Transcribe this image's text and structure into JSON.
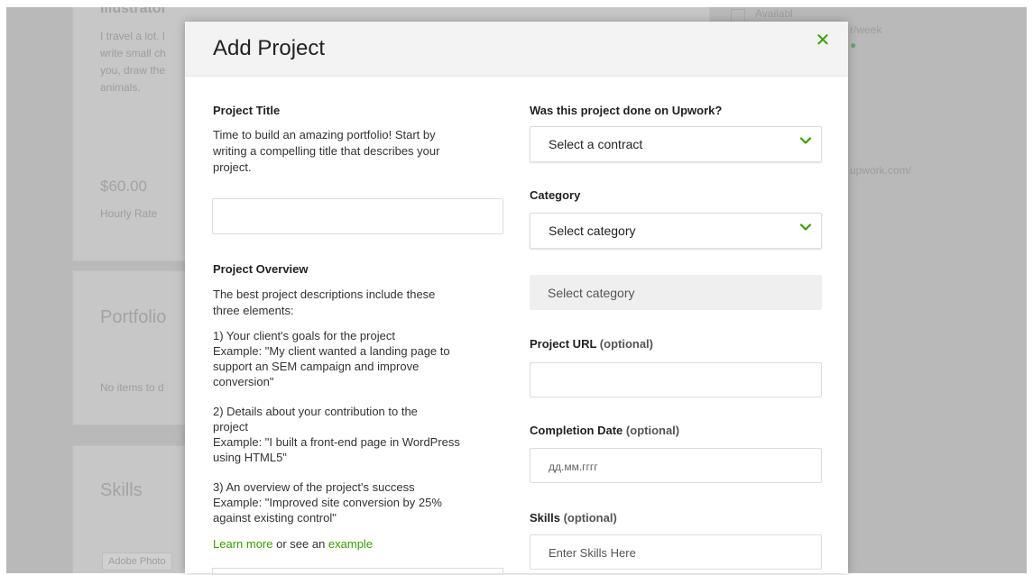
{
  "background": {
    "profile_title": "Illustrator",
    "bio_lines": [
      "I travel a lot. I",
      "write small ch",
      "you, draw the",
      "animals."
    ],
    "rate": "$60.00",
    "rate_label": "Hourly Rate",
    "portfolio_heading": "Portfolio",
    "portfolio_empty": "No items to d",
    "skills_heading": "Skills",
    "skill_chip": "Adobe Photo",
    "availability": "Availabl",
    "right_text_1": "r/week",
    "right_url": "upwork.com/"
  },
  "modal": {
    "title": "Add Project",
    "close_glyph": "✕",
    "project_title": {
      "label": "Project Title",
      "help_lines": [
        "Time to build an amazing portfolio! Start by",
        "writing a compelling title that describes your",
        "project."
      ],
      "value": ""
    },
    "project_overview": {
      "label": "Project Overview",
      "intro_lines": [
        "The best project descriptions include these",
        "three elements:"
      ],
      "item1_lines": [
        "1) Your client's goals for the project",
        "Example: \"My client wanted a landing page to",
        "support an SEM campaign and improve",
        "conversion\""
      ],
      "item2_lines": [
        "2) Details about your contribution to the",
        "project",
        "Example: \"I built a front-end page in WordPress",
        "using HTML5\""
      ],
      "item3_lines": [
        "3) An overview of the project's success",
        "Example: \"Improved site conversion by 25%",
        "against existing control\""
      ],
      "learn_more": "Learn more",
      "or_see_an": " or see an ",
      "example": "example"
    },
    "upwork_question": {
      "label": "Was this project done on Upwork?",
      "selected": "Select a contract"
    },
    "category": {
      "label": "Category",
      "selected": "Select category",
      "subcategory": "Select category"
    },
    "project_url": {
      "label": "Project URL",
      "optional": "(optional)",
      "value": ""
    },
    "completion_date": {
      "label": "Completion Date",
      "optional": "(optional)",
      "placeholder": "дд.мм.гггг"
    },
    "skills": {
      "label": "Skills",
      "optional": "(optional)",
      "placeholder": "Enter Skills Here"
    },
    "accent_color": "#37a000"
  }
}
